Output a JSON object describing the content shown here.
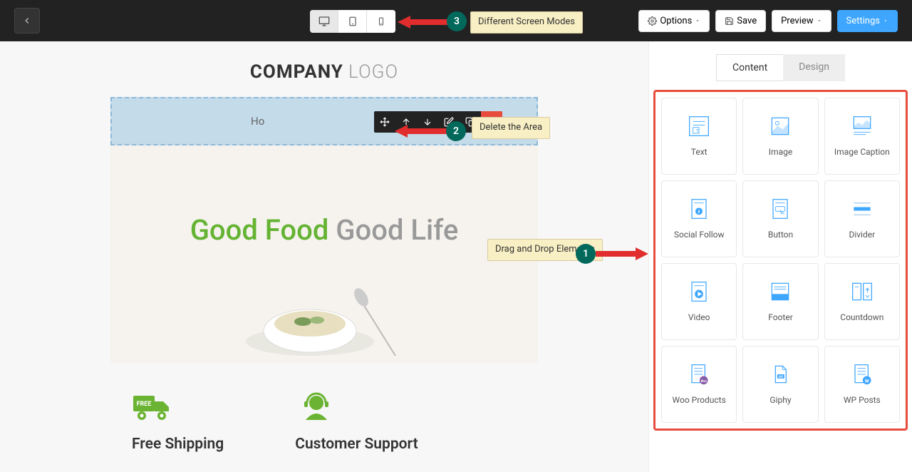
{
  "topbar": {
    "options": "Options",
    "save": "Save",
    "preview": "Preview",
    "settings": "Settings"
  },
  "canvas": {
    "logo_bold": "COMPANY",
    "logo_light": " LOGO",
    "nav_partial": "Ho",
    "hero_green": "Good Food",
    "hero_grey": " Good Life",
    "features": [
      {
        "title": "Free Shipping"
      },
      {
        "title": "Customer Support"
      }
    ]
  },
  "sidebar": {
    "tabs": {
      "content": "Content",
      "design": "Design"
    },
    "elements": [
      {
        "label": "Text"
      },
      {
        "label": "Image"
      },
      {
        "label": "Image Caption"
      },
      {
        "label": "Social Follow"
      },
      {
        "label": "Button"
      },
      {
        "label": "Divider"
      },
      {
        "label": "Video"
      },
      {
        "label": "Footer"
      },
      {
        "label": "Countdown"
      },
      {
        "label": "Woo Products"
      },
      {
        "label": "Giphy"
      },
      {
        "label": "WP Posts"
      }
    ]
  },
  "annotations": {
    "a1": {
      "num": "1",
      "text": "Drag and Drop Elements"
    },
    "a2": {
      "num": "2",
      "text": "Delete the Area"
    },
    "a3": {
      "num": "3",
      "text": "Different Screen Modes"
    }
  }
}
